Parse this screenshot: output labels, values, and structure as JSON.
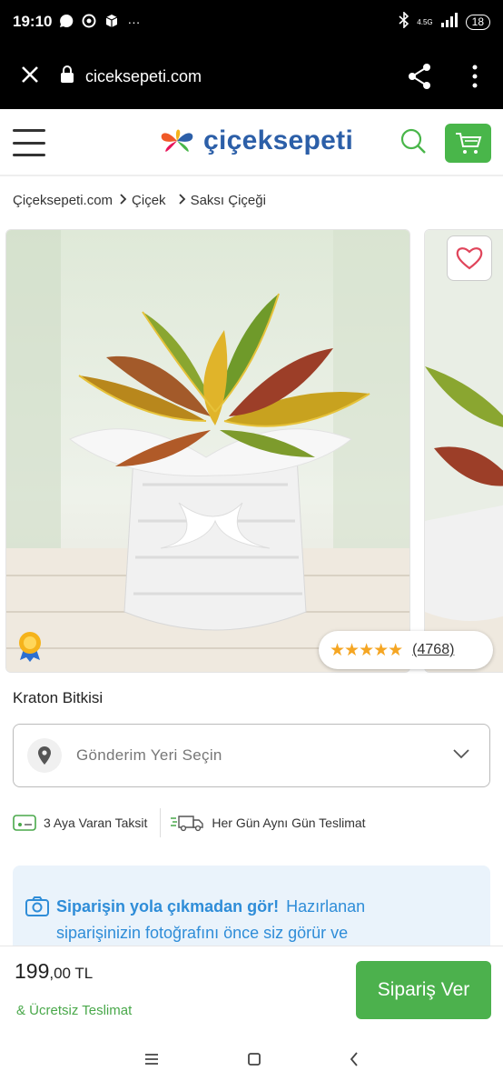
{
  "status_bar": {
    "time": "19:10",
    "network": "4.5G",
    "battery": "18",
    "more": "···"
  },
  "browser": {
    "url": "ciceksepeti.com"
  },
  "header": {
    "logo_text": "çiçeksepeti"
  },
  "breadcrumb": {
    "items": [
      "Çiçeksepeti.com",
      "Çiçek",
      "Saksı Çiçeği"
    ]
  },
  "product": {
    "title": "Kraton Bitkisi",
    "rating_stars": "★★★★★",
    "rating_value": 4.5,
    "review_count": "(4768)"
  },
  "location": {
    "placeholder": "Gönderim Yeri Seçin"
  },
  "features": {
    "installment": "3 Aya Varan Taksit",
    "delivery": "Her Gün Aynı Gün Teslimat"
  },
  "photo_banner": {
    "bold": "Siparişin yola çıkmadan gör!",
    "text1": "Hazırlanan",
    "text2": "siparişinizin fotoğrafını önce siz görür ve"
  },
  "purchase": {
    "price_main": "199",
    "price_decimal": ",00 TL",
    "free_delivery": "& Ücretsiz Teslimat",
    "order_button": "Sipariş Ver"
  },
  "colors": {
    "brand_blue": "#2c5fa8",
    "green": "#4cb14d",
    "info_blue": "#2f8dd8",
    "star": "#f5a623",
    "heart": "#e0455b"
  }
}
